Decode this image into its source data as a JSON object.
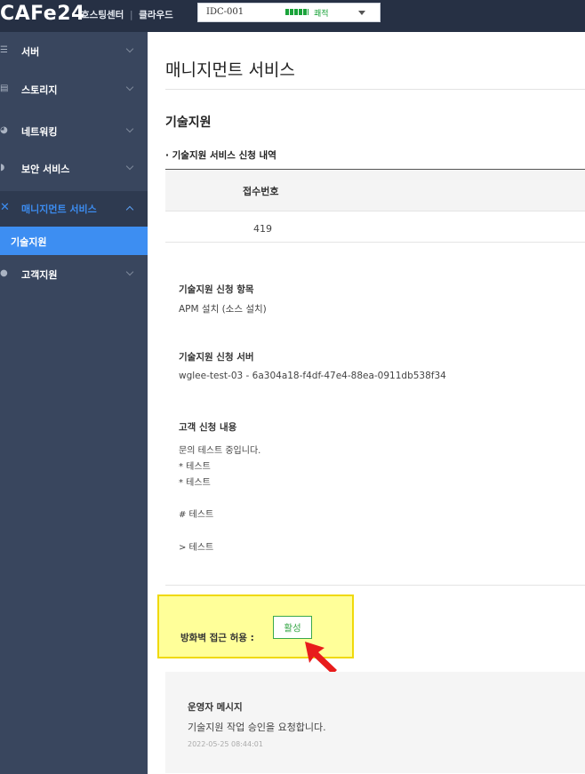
{
  "topbar": {
    "logo": "CAFe24",
    "brand_hosting": "호스팅센터",
    "brand_sep": "|",
    "brand_cloud": "클라우드",
    "idc_label": "IDC-001",
    "signal_text": "쾌적"
  },
  "sidebar": {
    "items": [
      {
        "label": "서버",
        "icon": "server-icon"
      },
      {
        "label": "스토리지",
        "icon": "storage-icon"
      },
      {
        "label": "네트워킹",
        "icon": "globe-icon"
      },
      {
        "label": "보안 서비스",
        "icon": "shield-icon"
      },
      {
        "label": "매니지먼트 서비스",
        "icon": "wrench-icon",
        "active": true
      },
      {
        "label": "고객지원",
        "icon": "user-icon"
      }
    ],
    "sub_item": "기술지원",
    "colors": {
      "bg": "#39465e",
      "active": "#3c8cf0",
      "sub_bg": "#3d8ef2"
    }
  },
  "main": {
    "page_title": "매니지먼트 서비스",
    "section_title": "기술지원",
    "list_title": "· 기술지원 서비스 신청 내역",
    "table": {
      "header": "접수번호",
      "value": "419"
    },
    "details": {
      "item_label": "기술지원 신청 항목",
      "item_value": "APM 설치 (소스 설치)",
      "server_label": "기술지원 신청 서버",
      "server_value": "wglee-test-03 - 6a304a18-f4df-47e4-88ea-0911db538f34",
      "request_label": "고객 신청 내용",
      "request_lines": [
        "문의 테스트 중입니다.",
        "* 테스트",
        "* 테스트",
        "# 테스트",
        "> 테스트"
      ]
    },
    "firewall": {
      "label": "방화벽 접근 허용 :",
      "button": "활성"
    },
    "operator": {
      "title": "운영자 메시지",
      "message": "기술지원 작업 승인을 요청합니다.",
      "date": "2022-05-25 08:44:01"
    }
  }
}
